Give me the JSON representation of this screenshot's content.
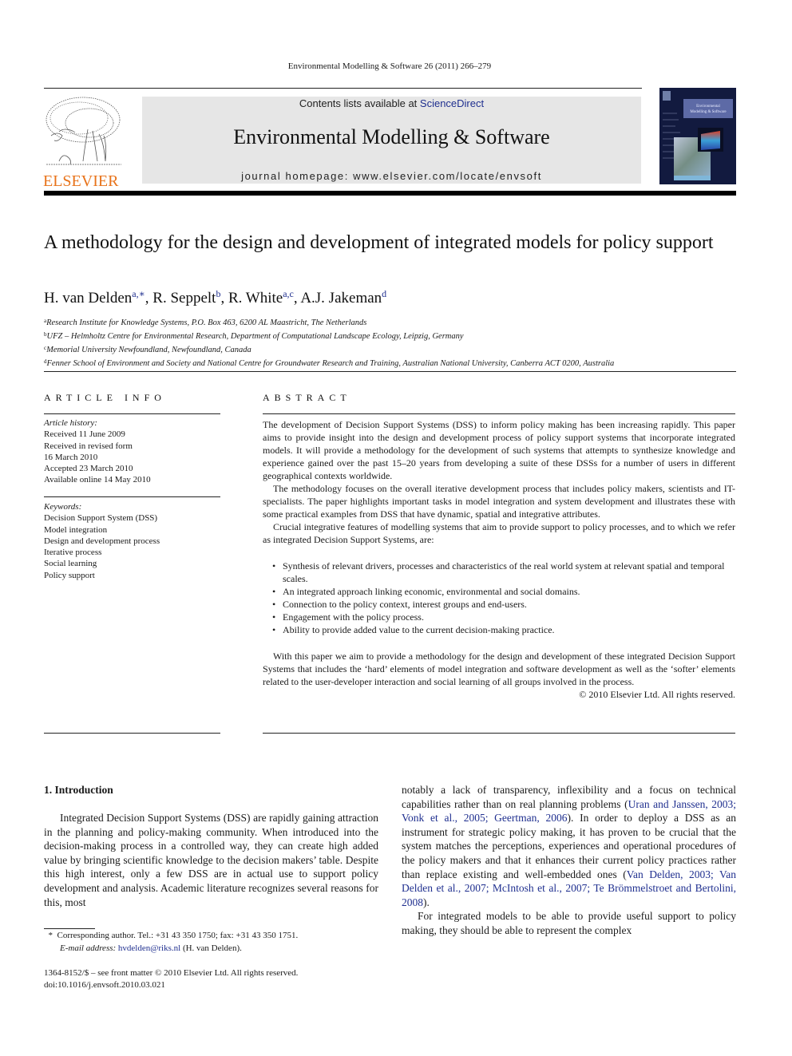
{
  "running_head": "Environmental Modelling & Software 26 (2011) 266–279",
  "publisher": {
    "logo_text": "ELSEVIER",
    "logo_color": "#e8731a"
  },
  "banner": {
    "contents_prefix": "Contents lists available at ",
    "contents_link": "ScienceDirect",
    "journal_title": "Environmental Modelling & Software",
    "homepage": "journal homepage: www.elsevier.com/locate/envsoft",
    "background": "#e6e6e6"
  },
  "cover": {
    "title_line1": "Environmental",
    "title_line2": "Modelling & Software",
    "background": "#121a3f"
  },
  "article": {
    "title": "A methodology for the design and development of integrated models for policy support",
    "authors": [
      {
        "name": "H. van Delden",
        "sup": "a,∗",
        "sep": ", "
      },
      {
        "name": "R. Seppelt",
        "sup": "b",
        "sep": ", "
      },
      {
        "name": "R. White",
        "sup": "a,c",
        "sep": ", "
      },
      {
        "name": "A.J. Jakeman",
        "sup": "d",
        "sep": ""
      }
    ],
    "affiliations": [
      {
        "mark": "a",
        "text": "Research Institute for Knowledge Systems, P.O. Box 463, 6200 AL Maastricht, The Netherlands"
      },
      {
        "mark": "b",
        "text": "UFZ – Helmholtz Centre for Environmental Research, Department of Computational Landscape Ecology, Leipzig, Germany"
      },
      {
        "mark": "c",
        "text": "Memorial University Newfoundland, Newfoundland, Canada"
      },
      {
        "mark": "d",
        "text": "Fenner School of Environment and Society and National Centre for Groundwater Research and Training, Australian National University, Canberra ACT 0200, Australia"
      }
    ]
  },
  "article_info": {
    "heading": "ARTICLE INFO",
    "history_label": "Article history:",
    "history": [
      "Received 11 June 2009",
      "Received in revised form",
      "16 March 2010",
      "Accepted 23 March 2010",
      "Available online 14 May 2010"
    ],
    "keywords_label": "Keywords:",
    "keywords": [
      "Decision Support System (DSS)",
      "Model integration",
      "Design and development process",
      "Iterative process",
      "Social learning",
      "Policy support"
    ]
  },
  "abstract": {
    "heading": "ABSTRACT",
    "paragraphs": [
      "The development of Decision Support Systems (DSS) to inform policy making has been increasing rapidly. This paper aims to provide insight into the design and development process of policy support systems that incorporate integrated models. It will provide a methodology for the development of such systems that attempts to synthesize knowledge and experience gained over the past 15–20 years from developing a suite of these DSSs for a number of users in different geographical contexts worldwide.",
      "The methodology focuses on the overall iterative development process that includes policy makers, scientists and IT-specialists. The paper highlights important tasks in model integration and system development and illustrates these with some practical examples from DSS that have dynamic, spatial and integrative attributes.",
      "Crucial integrative features of modelling systems that aim to provide support to policy processes, and to which we refer as integrated Decision Support Systems, are:"
    ],
    "bullets": [
      "Synthesis of relevant drivers, processes and characteristics of the real world system at relevant spatial and temporal scales.",
      "An integrated approach linking economic, environmental and social domains.",
      "Connection to the policy context, interest groups and end-users.",
      "Engagement with the policy process.",
      "Ability to provide added value to the current decision-making practice."
    ],
    "closing": "With this paper we aim to provide a methodology for the design and development of these integrated Decision Support Systems that includes the ‘hard’ elements of model integration and software development as well as the ‘softer’ elements related to the user-developer interaction and social learning of all groups involved in the process.",
    "copyright": "© 2010 Elsevier Ltd. All rights reserved."
  },
  "introduction": {
    "heading": "1.  Introduction",
    "left_paragraph": "Integrated Decision Support Systems (DSS) are rapidly gaining attraction in the planning and policy-making community. When introduced into the decision-making process in a controlled way, they can create high added value by bringing scientific knowledge to the decision makers’ table. Despite this high interest, only a few DSS are in actual use to support policy development and analysis. Academic literature recognizes several reasons for this, most",
    "right_p1": {
      "t1": "notably a lack of transparency, inflexibility and a focus on technical capabilities rather than on real planning problems (",
      "c1": "Uran and Janssen, 2003; Vonk et al., 2005; Geertman, 2006",
      "t2": "). In order to deploy a DSS as an instrument for strategic policy making, it has proven to be crucial that the system matches the perceptions, experiences and operational procedures of the policy makers and that it enhances their current policy practices rather than replace existing and well-embedded ones (",
      "c2": "Van Delden, 2003; Van Delden et al., 2007; McIntosh et al., 2007; Te Brömmelstroet and Bertolini, 2008",
      "t3": ")."
    },
    "right_p2": "For integrated models to be able to provide useful support to policy making, they should be able to represent the complex"
  },
  "footnote": {
    "mark": "*",
    "text": "Corresponding author. Tel.: +31 43 350 1750; fax: +31 43 350 1751.",
    "email_label": "E-mail address: ",
    "email": "hvdelden@riks.nl",
    "email_suffix": " (H. van Delden)."
  },
  "front_matter": {
    "line1": "1364-8152/$ – see front matter © 2010 Elsevier Ltd. All rights reserved.",
    "doi": "doi:10.1016/j.envsoft.2010.03.021"
  },
  "colors": {
    "link": "#1f2f8f",
    "text": "#1a1a1a"
  }
}
